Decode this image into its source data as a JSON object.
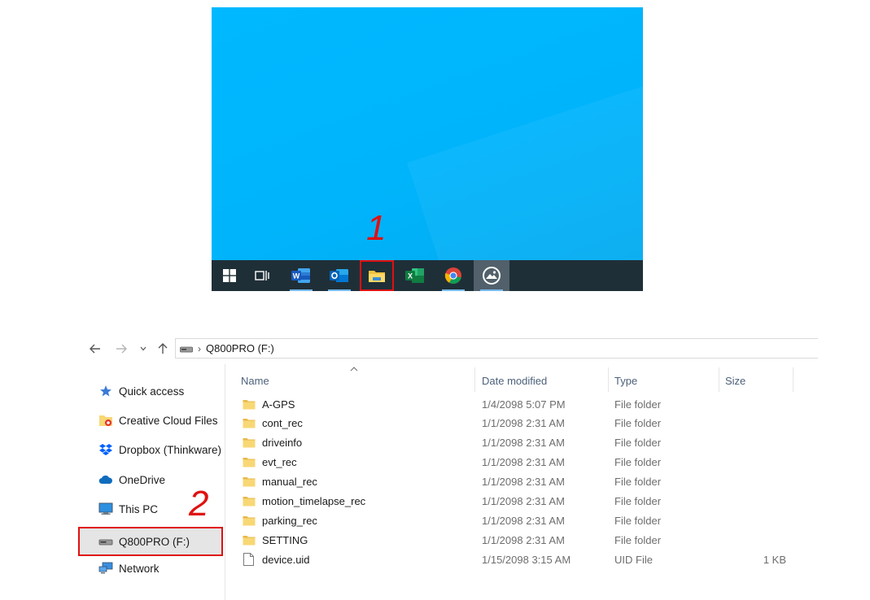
{
  "annotations": {
    "step1": "1",
    "step2": "2"
  },
  "colors": {
    "annotation": "#e01010",
    "desktop": "#00b4fb",
    "taskbar": "#1f2f38",
    "folder": "#f8d775"
  },
  "taskbar": {
    "icons": [
      "windows-start-icon",
      "task-view-icon",
      "word-icon",
      "outlook-icon",
      "file-explorer-icon",
      "excel-icon",
      "chrome-icon",
      "photos-app-icon"
    ]
  },
  "explorer": {
    "address": {
      "drive_label": "Q800PRO (F:)"
    },
    "nav": {
      "quick_access": "Quick access",
      "creative_cloud": "Creative Cloud Files",
      "dropbox": "Dropbox (Thinkware)",
      "onedrive": "OneDrive",
      "this_pc": "This PC",
      "drive": "Q800PRO (F:)",
      "network": "Network"
    },
    "columns": {
      "name": "Name",
      "date": "Date modified",
      "type": "Type",
      "size": "Size"
    },
    "files": [
      {
        "name": "A-GPS",
        "date": "1/4/2098 5:07 PM",
        "type": "File folder",
        "size": ""
      },
      {
        "name": "cont_rec",
        "date": "1/1/2098 2:31 AM",
        "type": "File folder",
        "size": ""
      },
      {
        "name": "driveinfo",
        "date": "1/1/2098 2:31 AM",
        "type": "File folder",
        "size": ""
      },
      {
        "name": "evt_rec",
        "date": "1/1/2098 2:31 AM",
        "type": "File folder",
        "size": ""
      },
      {
        "name": "manual_rec",
        "date": "1/1/2098 2:31 AM",
        "type": "File folder",
        "size": ""
      },
      {
        "name": "motion_timelapse_rec",
        "date": "1/1/2098 2:31 AM",
        "type": "File folder",
        "size": ""
      },
      {
        "name": "parking_rec",
        "date": "1/1/2098 2:31 AM",
        "type": "File folder",
        "size": ""
      },
      {
        "name": "SETTING",
        "date": "1/1/2098 2:31 AM",
        "type": "File folder",
        "size": ""
      },
      {
        "name": "device.uid",
        "date": "1/15/2098 3:15 AM",
        "type": "UID File",
        "size": "1 KB"
      }
    ]
  }
}
